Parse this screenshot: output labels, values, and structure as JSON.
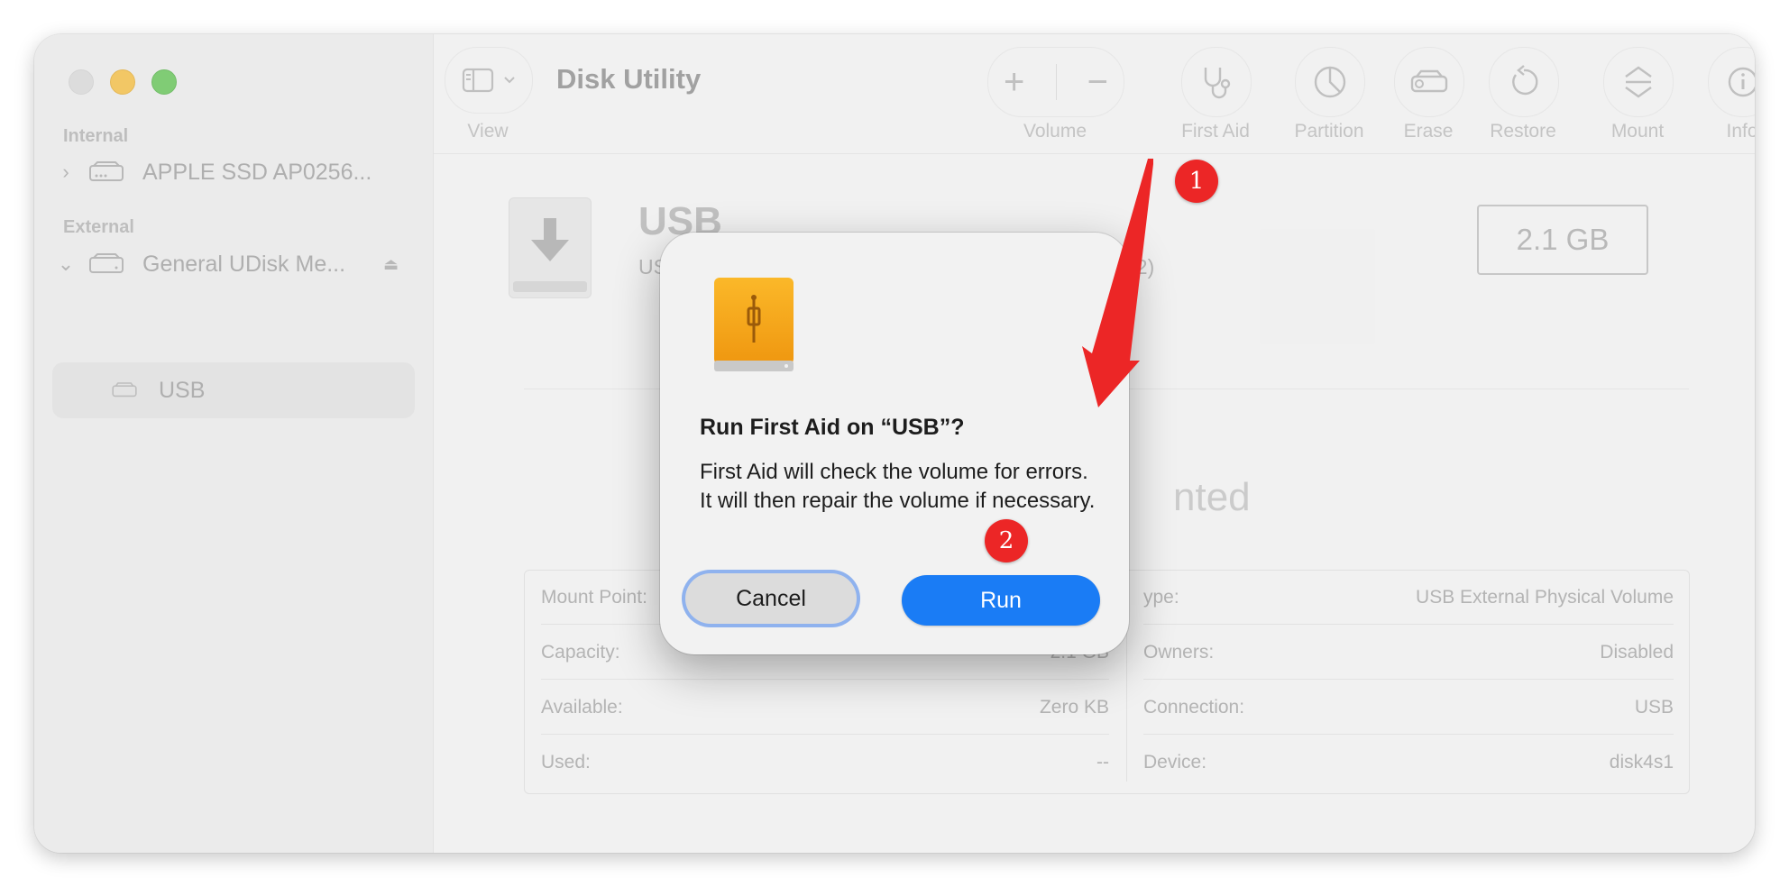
{
  "app": {
    "title": "Disk Utility"
  },
  "sidebar": {
    "sections": [
      {
        "label": "Internal",
        "items": [
          {
            "label": "APPLE SSD AP0256..."
          }
        ]
      },
      {
        "label": "External",
        "items": [
          {
            "label": "General UDisk Me..."
          },
          {
            "label": "USB"
          }
        ]
      }
    ]
  },
  "toolbar": {
    "view_label": "View",
    "volume_label": "Volume",
    "first_aid_label": "First Aid",
    "partition_label": "Partition",
    "erase_label": "Erase",
    "restore_label": "Restore",
    "mount_label": "Mount",
    "info_label": "Info"
  },
  "volume": {
    "name": "USB",
    "subtitle_prefix": "US",
    "subtitle_suffix": "32)",
    "capacity": "2.1 GB",
    "status_fragment": "nted"
  },
  "info": {
    "left": [
      {
        "label": "Mount Point:",
        "value": ""
      },
      {
        "label": "Capacity:",
        "value": "2.1 GB"
      },
      {
        "label": "Available:",
        "value": "Zero KB"
      },
      {
        "label": "Used:",
        "value": "--"
      }
    ],
    "right": [
      {
        "label": "ype:",
        "value": "USB External Physical Volume"
      },
      {
        "label": "Owners:",
        "value": "Disabled"
      },
      {
        "label": "Connection:",
        "value": "USB"
      },
      {
        "label": "Device:",
        "value": "disk4s1"
      }
    ]
  },
  "dialog": {
    "title": "Run First Aid on “USB”?",
    "message": "First Aid will check the volume for errors. It will then repair the volume if necessary.",
    "cancel_label": "Cancel",
    "run_label": "Run"
  },
  "annotations": {
    "step1": "1",
    "step2": "2",
    "color": "#ec2626"
  },
  "colors": {
    "accent": "#1a7cf5",
    "usb_drive_orange": "#f5a31a"
  }
}
